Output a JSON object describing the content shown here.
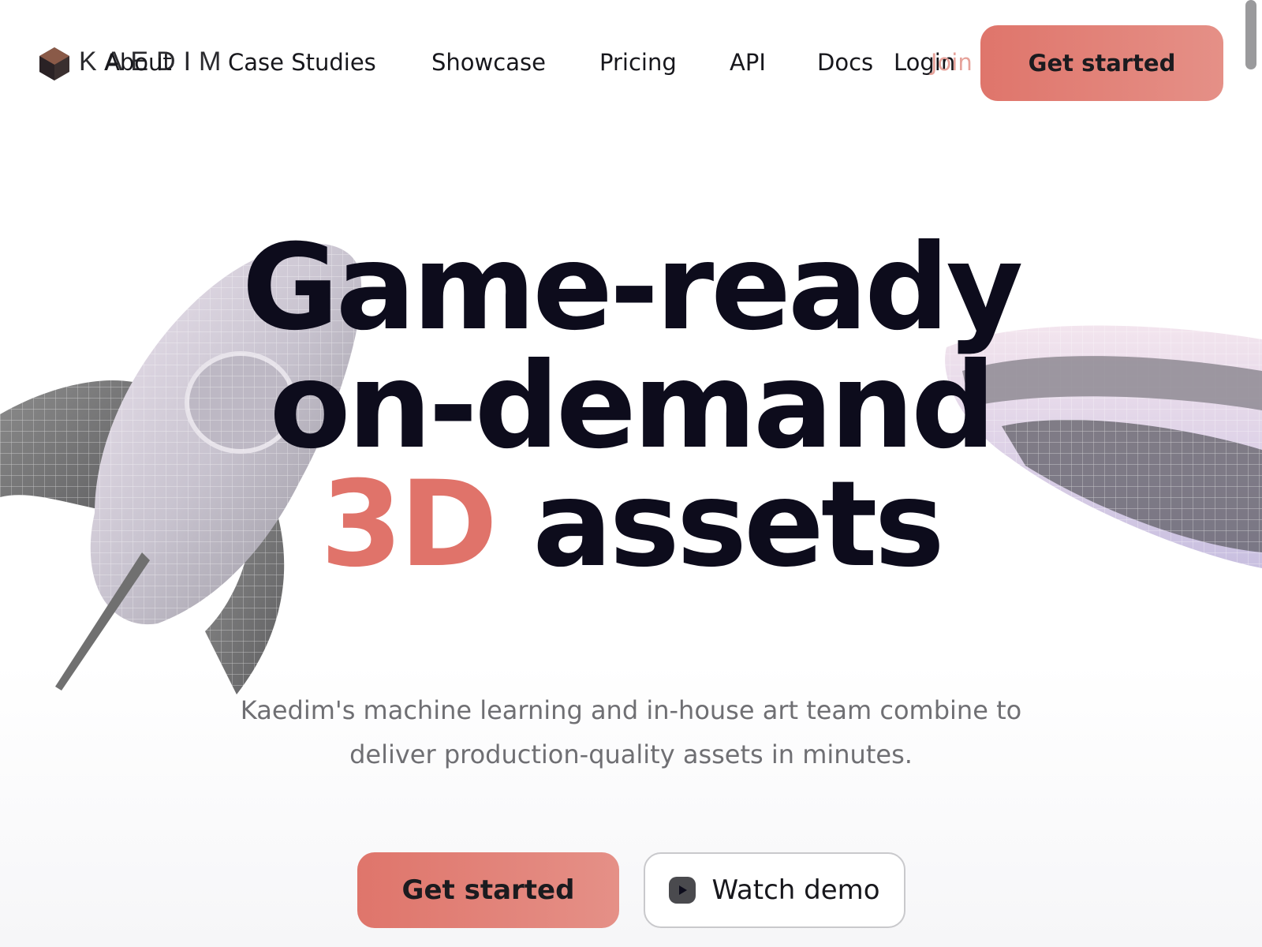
{
  "brand": {
    "name": "KAEDIM"
  },
  "nav": {
    "links": [
      "About",
      "Case Studies",
      "Showcase",
      "Pricing",
      "API",
      "Docs",
      "Login",
      "Join Us"
    ],
    "cta_label": "Get started"
  },
  "hero": {
    "headline_line1": "Game-ready",
    "headline_line2": "on-demand",
    "headline_accent": "3D",
    "headline_rest": "assets",
    "subtitle": "Kaedim's machine learning and in-house art team combine to deliver production-quality assets in minutes.",
    "primary_cta": "Get started",
    "secondary_cta": "Watch demo"
  },
  "colors": {
    "accent": "#e0736a",
    "headline": "#0d0c1c",
    "body_text": "#6f6f73"
  },
  "icons": [
    "kaedim-logo-icon",
    "play-icon"
  ]
}
